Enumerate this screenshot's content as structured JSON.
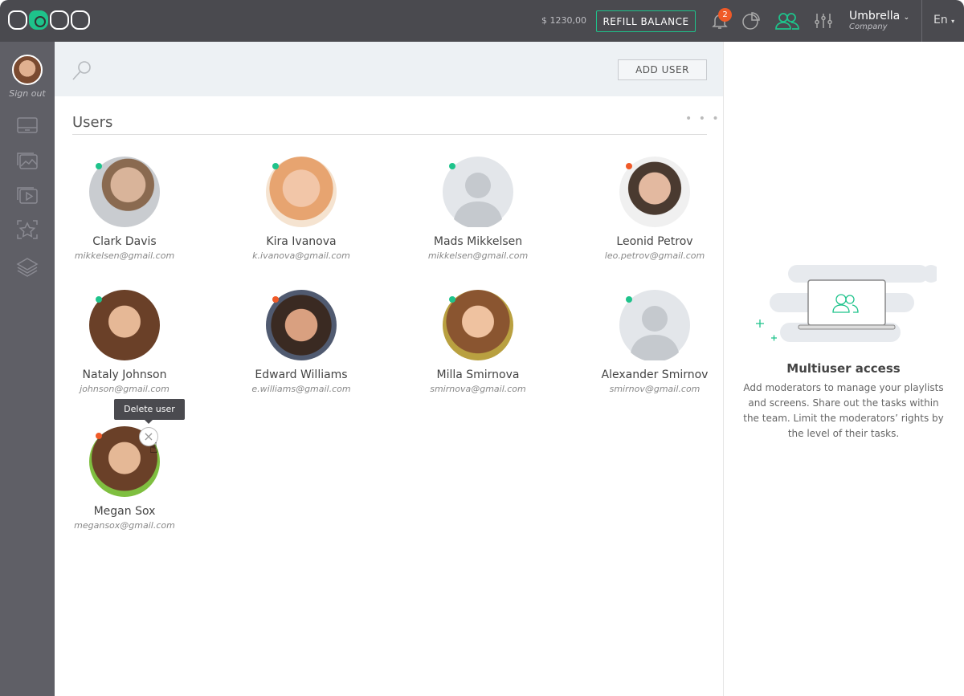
{
  "header": {
    "logo": "LOOK",
    "balance": "$ 1230,00",
    "refill_label": "REFILL BALANCE",
    "notifications_count": "2",
    "company_name": "Umbrella",
    "company_sub": "Company",
    "language": "En"
  },
  "sidebar": {
    "sign_out": "Sign out",
    "items": [
      "screens-icon",
      "images-icon",
      "videos-icon",
      "effects-icon",
      "layers-icon"
    ]
  },
  "toolbar": {
    "add_user_label": "ADD USER"
  },
  "users_section": {
    "title": "Users",
    "more": "• • •"
  },
  "users": [
    {
      "name": "Clark Davis",
      "email": "mikkelsen@gmail.com",
      "status": "online"
    },
    {
      "name": "Kira Ivanova",
      "email": "k.ivanova@gmail.com",
      "status": "online"
    },
    {
      "name": "Mads Mikkelsen",
      "email": "mikkelsen@gmail.com",
      "status": "online"
    },
    {
      "name": "Leonid Petrov",
      "email": "leo.petrov@gmail.com",
      "status": "busy"
    },
    {
      "name": "Nataly Johnson",
      "email": "johnson@gmail.com",
      "status": "online"
    },
    {
      "name": "Edward Williams",
      "email": "e.williams@gmail.com",
      "status": "busy"
    },
    {
      "name": "Milla Smirnova",
      "email": "smirnova@gmail.com",
      "status": "online"
    },
    {
      "name": "Alexander Smirnov",
      "email": "smirnov@gmail.com",
      "status": "online"
    },
    {
      "name": "Megan Sox",
      "email": "megansox@gmail.com",
      "status": "busy"
    }
  ],
  "tooltip": "Delete user",
  "info_panel": {
    "title": "Multiuser access",
    "description": "Add moderators to manage your playlists and screens. Share out the tasks within the team. Limit the moderators’ rights by the level of their tasks."
  },
  "colors": {
    "accent": "#1ec38b",
    "online": "#1ec38b",
    "busy": "#f05a28",
    "header": "#4a4a4f",
    "sidebar": "#5f5f66"
  }
}
